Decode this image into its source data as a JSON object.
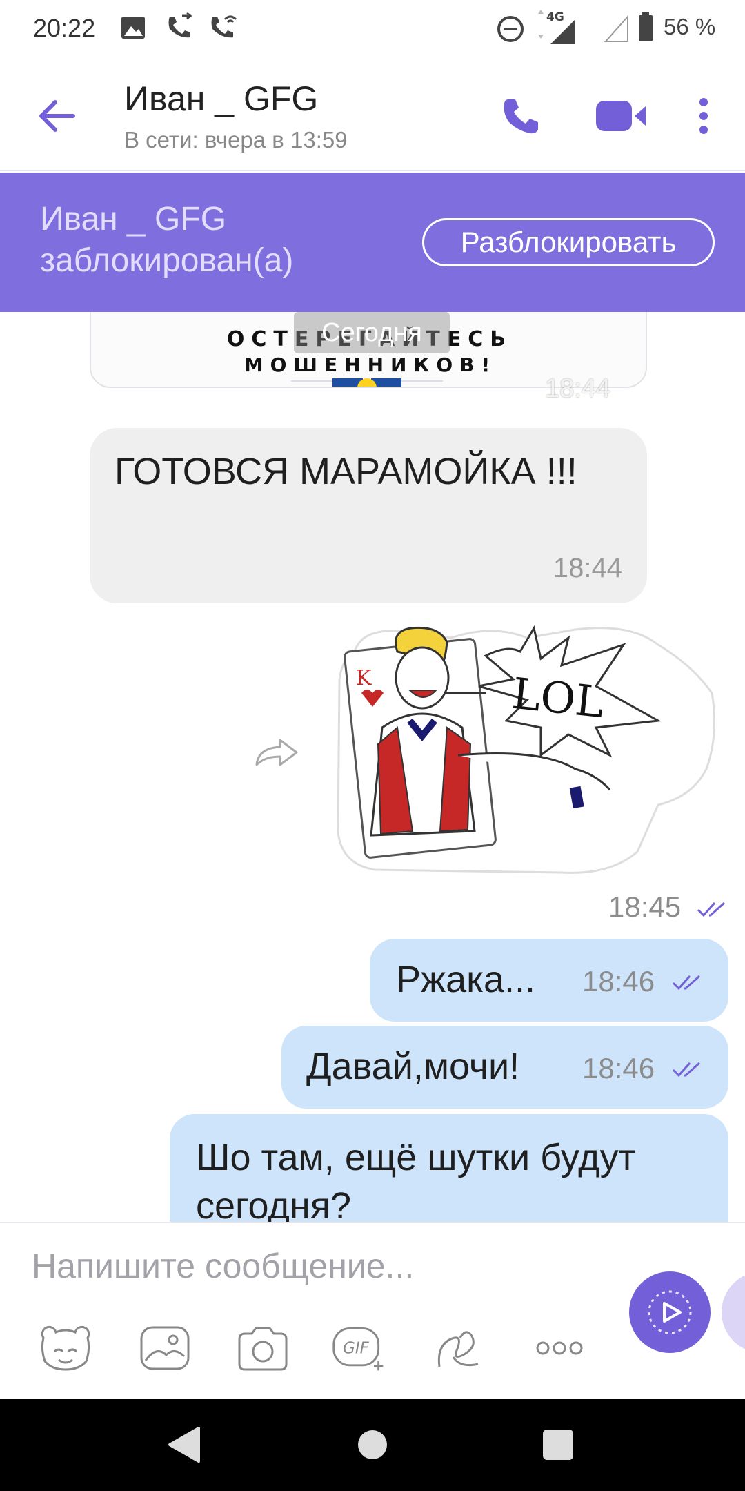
{
  "status_bar": {
    "time": "20:22",
    "network": "4G",
    "battery": "56 %",
    "icons": [
      "gallery-icon",
      "call-forwarded-icon",
      "call-wifi-icon",
      "do-not-disturb-icon",
      "signal-icon",
      "battery-icon"
    ]
  },
  "header": {
    "contact_name": "Иван _ GFG",
    "status": "В сети: вчера в 13:59",
    "icons": [
      "back-arrow-icon",
      "phone-icon",
      "video-icon",
      "more-vert-icon"
    ]
  },
  "banner": {
    "text": "Иван _ GFG заблокирован(а)",
    "unblock_label": "Разблокировать"
  },
  "chat": {
    "date_separator": "Сегодня",
    "image_message": {
      "line1": "ОСТЕРЕГАЙТЕСЬ",
      "line2": "МОШЕННИКОВ!",
      "time": "18:44"
    },
    "incoming": {
      "text": "ГОТОВСЯ МАРАМОЙКА !!!",
      "time": "18:44"
    },
    "sticker": {
      "caption": "LOL",
      "card_letter": "K",
      "time": "18:45"
    },
    "outgoing": [
      {
        "text": "Ржака...",
        "time": "18:46"
      },
      {
        "text": "Давай,мочи!",
        "time": "18:46"
      },
      {
        "text": "Шо там, ещё шутки будут сегодня?"
      }
    ]
  },
  "composer": {
    "placeholder": "Напишите сообщение...",
    "gif_label": "GIF",
    "tools": [
      "sticker-bear-icon",
      "gallery-icon",
      "camera-icon",
      "gif-icon",
      "doodle-icon",
      "more-horiz-icon"
    ]
  },
  "colors": {
    "accent": "#7360d8",
    "banner": "#7f6fde",
    "outgoing_bubble": "#cde4fb",
    "incoming_bubble": "#efefef"
  }
}
